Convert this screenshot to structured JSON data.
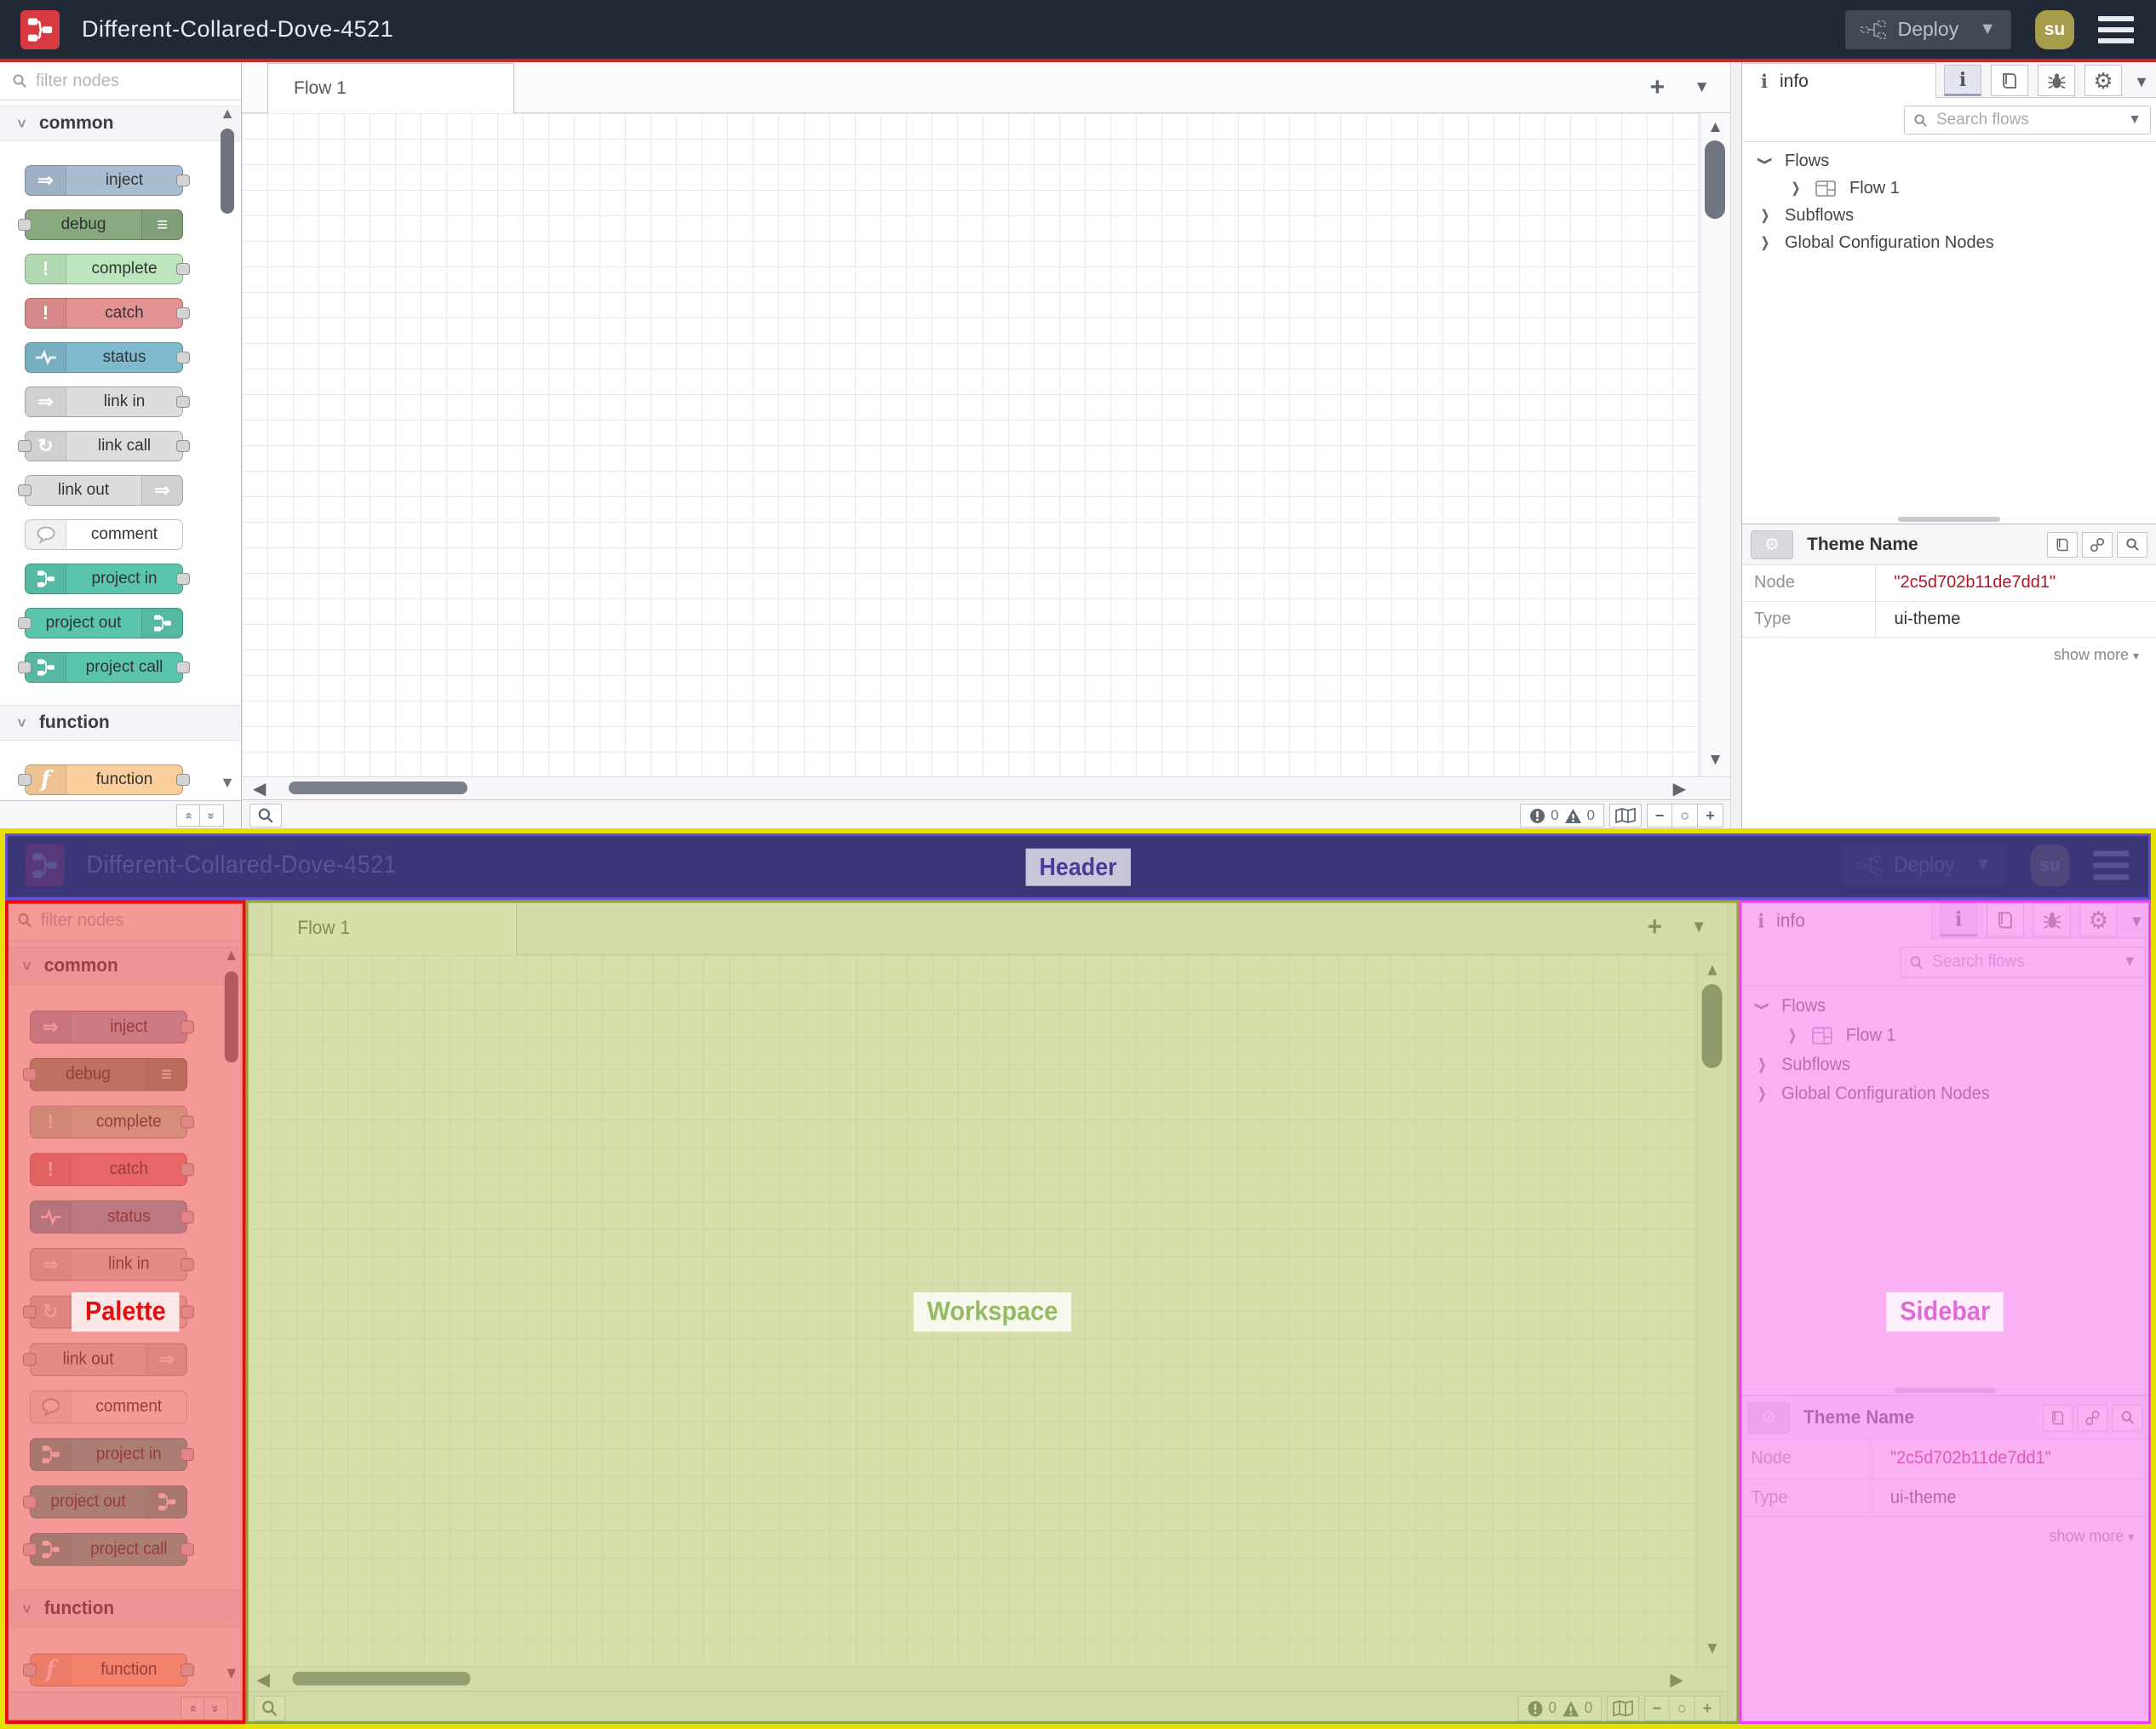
{
  "header": {
    "title": "Different-Collared-Dove-4521",
    "deploy_label": "Deploy",
    "avatar_text": "su"
  },
  "palette": {
    "filter_placeholder": "filter nodes",
    "categories": [
      {
        "label": "common",
        "nodes": [
          {
            "label": "inject",
            "color": "#a9bdd1",
            "icon": "inject-arrow-icon",
            "icon_side": "left",
            "ports": "right"
          },
          {
            "label": "debug",
            "color": "#87a980",
            "icon": "debug-list-icon",
            "icon_side": "right",
            "ports": "left"
          },
          {
            "label": "complete",
            "color": "#bee6be",
            "icon": "exclamation-icon",
            "icon_side": "left",
            "ports": "right"
          },
          {
            "label": "catch",
            "color": "#e49191",
            "icon": "exclamation-icon",
            "icon_side": "left",
            "ports": "right"
          },
          {
            "label": "status",
            "color": "#7fb9cd",
            "icon": "pulse-icon",
            "icon_side": "left",
            "ports": "right"
          },
          {
            "label": "link in",
            "color": "#dddddd",
            "icon": "link-arrow-icon",
            "icon_side": "left",
            "ports": "right"
          },
          {
            "label": "link call",
            "color": "#dddddd",
            "icon": "link-call-icon",
            "icon_side": "left",
            "ports": "both"
          },
          {
            "label": "link out",
            "color": "#dddddd",
            "icon": "link-arrow-icon",
            "icon_side": "right",
            "ports": "left"
          },
          {
            "label": "comment",
            "color": "#ffffff",
            "icon": "comment-bubble-icon",
            "icon_side": "left",
            "ports": "none"
          },
          {
            "label": "project in",
            "color": "#5bc4ad",
            "icon": "node-red-icon",
            "icon_side": "left",
            "ports": "right"
          },
          {
            "label": "project out",
            "color": "#5bc4ad",
            "icon": "node-red-icon",
            "icon_side": "right",
            "ports": "left"
          },
          {
            "label": "project call",
            "color": "#5bc4ad",
            "icon": "node-red-icon",
            "icon_side": "left",
            "ports": "both"
          }
        ]
      },
      {
        "label": "function",
        "nodes": [
          {
            "label": "function",
            "color": "#fbcf9d",
            "icon": "function-f-icon",
            "icon_side": "left",
            "ports": "both"
          }
        ]
      }
    ]
  },
  "workspace": {
    "tab_label": "Flow 1",
    "error_count": "0",
    "warning_count": "0"
  },
  "sidebar": {
    "tab_label": "info",
    "search_placeholder": "Search flows",
    "tree": {
      "flows_label": "Flows",
      "flow1_label": "Flow 1",
      "subflows_label": "Subflows",
      "global_label": "Global Configuration Nodes"
    },
    "theme": {
      "title": "Theme Name",
      "node_label": "Node",
      "node_value": "\"2c5d702b11de7dd1\"",
      "type_label": "Type",
      "type_value": "ui-theme",
      "show_more": "show more"
    }
  },
  "annotations": {
    "header_label": "Header",
    "palette_label": "Palette",
    "workspace_label": "Workspace",
    "sidebar_label": "Sidebar",
    "colors": {
      "outer_border": "#e6df00",
      "header_overlay": "#4038a4",
      "palette_overlay": "#e80e0e",
      "workspace_overlay": "#93a437",
      "sidebar_overlay": "#f23cea"
    }
  },
  "ui_colors": {
    "header_bg": "#212936",
    "header_accent_line": "#c62828",
    "brand_red": "#d93a41",
    "avatar_bg": "#a79b4c",
    "node_id_value_red": "#ad1625"
  }
}
